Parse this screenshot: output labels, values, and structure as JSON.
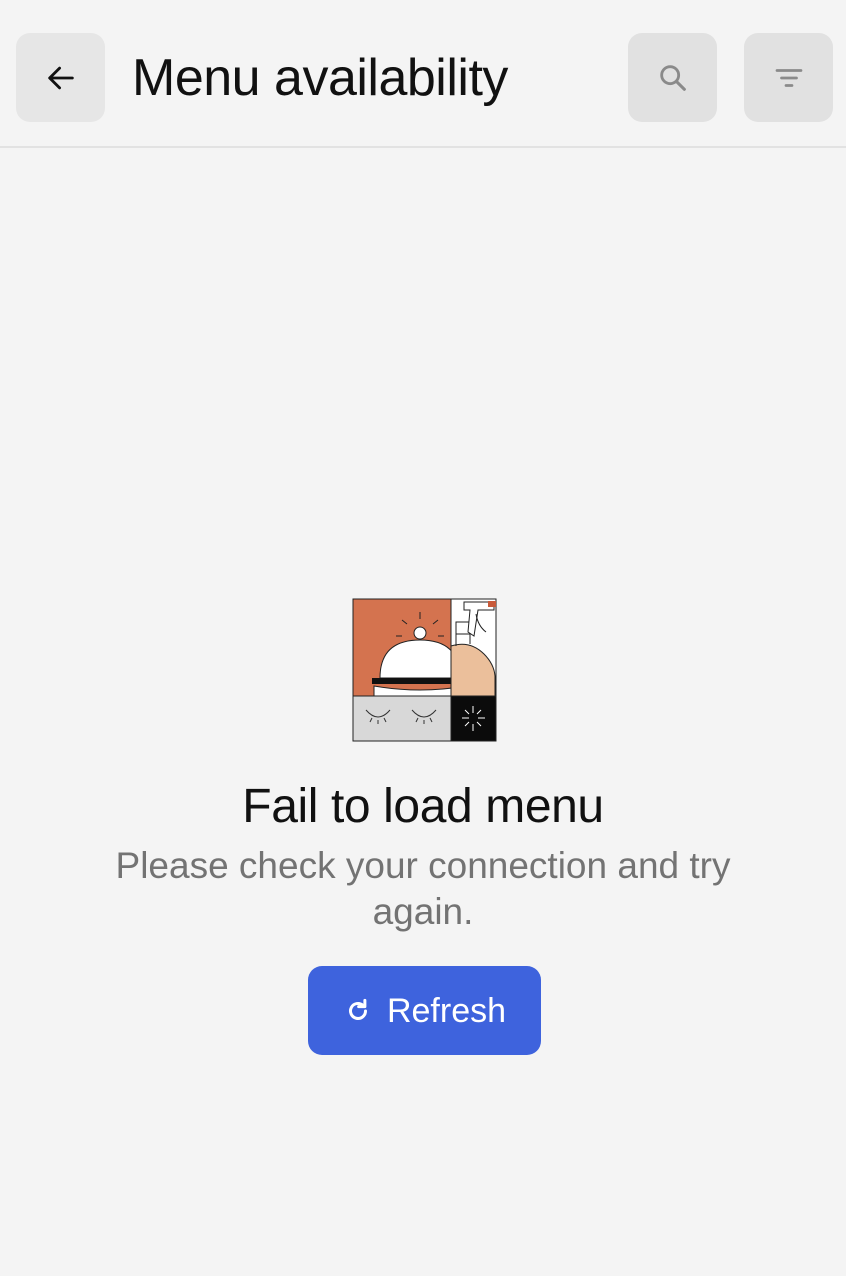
{
  "header": {
    "title": "Menu availability",
    "back_icon": "arrow-left-icon",
    "search_icon": "search-icon",
    "filter_icon": "filter-icon"
  },
  "empty_state": {
    "illustration": "service-bell-cleaning-illustration",
    "title": "Fail to load menu",
    "message": "Please check your connection and try again.",
    "refresh_label": "Refresh",
    "refresh_icon": "refresh-icon"
  },
  "colors": {
    "background": "#f4f4f4",
    "primary": "#3e63dd",
    "icon_button": "#e6e6e6",
    "muted_text": "#737373",
    "illustration_orange": "#d4734f",
    "illustration_peach": "#ebbf9b"
  }
}
